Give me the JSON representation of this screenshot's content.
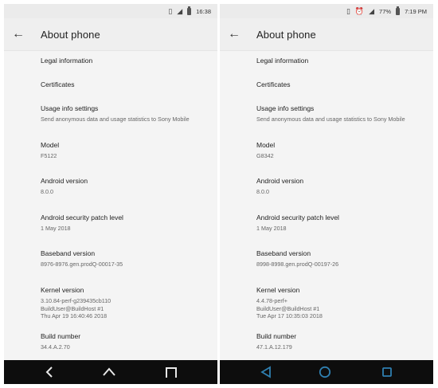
{
  "left": {
    "status": {
      "time": "16:38",
      "icons": [
        "vibrate-icon",
        "signal-icon",
        "battery-icon"
      ]
    },
    "title": "About phone",
    "items": [
      {
        "title": "Legal information",
        "sub": ""
      },
      {
        "title": "Certificates",
        "sub": ""
      },
      {
        "title": "Usage info settings",
        "sub": "Send anonymous data and usage statistics to Sony Mobile"
      },
      {
        "title": "Model",
        "sub": "F5122"
      },
      {
        "title": "Android version",
        "sub": "8.0.0"
      },
      {
        "title": "Android security patch level",
        "sub": "1 May 2018"
      },
      {
        "title": "Baseband version",
        "sub": "8976-8976.gen.prodQ-00017-35"
      },
      {
        "title": "Kernel version",
        "sub": "3.10.84-perf-g239435cb110\nBuildUser@BuildHost #1\nThu Apr 19 16:40:46 2018"
      },
      {
        "title": "Build number",
        "sub": "34.4.A.2.70"
      }
    ]
  },
  "right": {
    "status": {
      "time": "7:19 PM",
      "battery": "77%",
      "icons": [
        "vibrate-icon",
        "alarm-icon",
        "signal-icon",
        "battery-icon"
      ]
    },
    "title": "About phone",
    "items": [
      {
        "title": "Legal information",
        "sub": ""
      },
      {
        "title": "Certificates",
        "sub": ""
      },
      {
        "title": "Usage info settings",
        "sub": "Send anonymous data and usage statistics to Sony Mobile"
      },
      {
        "title": "Model",
        "sub": "G8342"
      },
      {
        "title": "Android version",
        "sub": "8.0.0"
      },
      {
        "title": "Android security patch level",
        "sub": "1 May 2018"
      },
      {
        "title": "Baseband version",
        "sub": "8998-8998.gen.prodQ-00197-26"
      },
      {
        "title": "Kernel version",
        "sub": "4.4.78-perf+\nBuildUser@BuildHost #1\nTue Apr 17 10:35:03 2018"
      },
      {
        "title": "Build number",
        "sub": "47.1.A.12.179"
      }
    ]
  },
  "colors": {
    "nav_icon_left": "#e8e8e8",
    "nav_icon_right": "#2f7fb0",
    "navbar": "#0d0d0d"
  }
}
